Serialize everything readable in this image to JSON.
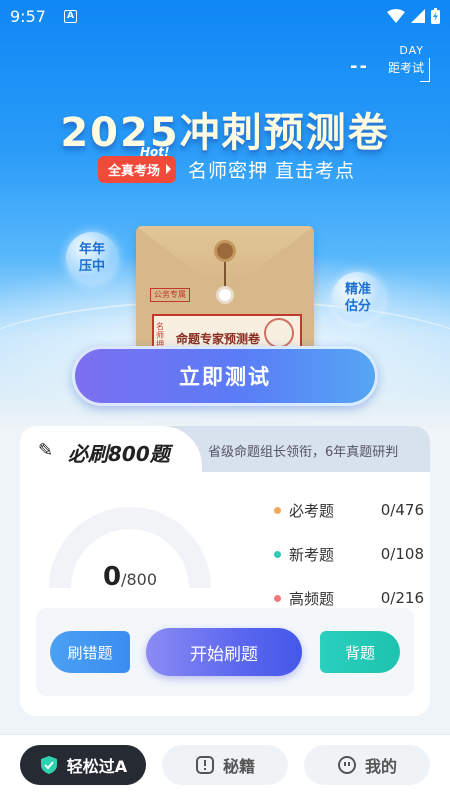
{
  "status_bar": {
    "time": "9:57",
    "sim_badge": "A"
  },
  "countdown": {
    "value": "--",
    "unit": "DAY",
    "label": "距考试"
  },
  "hero": {
    "headline": "2025冲刺预测卷",
    "tag": "全真考场",
    "hot": "Hot!",
    "slogan": "名师密押 直击考点",
    "bubble_left": "年年\n压中",
    "bubble_right": "精准\n估分",
    "envelope_stamp": "公务专属",
    "envelope_title": "命题专家预测卷",
    "envelope_side": "名师押"
  },
  "test_button": {
    "label": "立即测试"
  },
  "practice": {
    "title": "必刷800题",
    "subtitle": "省级命题组长领衔，6年真题研判",
    "progress_done": "0",
    "progress_total": "/800",
    "progress_fraction": 0,
    "stats": [
      {
        "label": "必考题",
        "value": "0/476",
        "color": "#f5a85a"
      },
      {
        "label": "新考题",
        "value": "0/108",
        "color": "#2cc9b3"
      },
      {
        "label": "高频题",
        "value": "0/216",
        "color": "#f2787a"
      }
    ],
    "btn_wrong": "刷错题",
    "btn_start": "开始刷题",
    "btn_recite": "背题"
  },
  "tabs": [
    {
      "label": "轻松过A",
      "icon": "shield-check-icon",
      "active": true
    },
    {
      "label": "秘籍",
      "icon": "book-alert-icon",
      "active": false
    },
    {
      "label": "我的",
      "icon": "face-icon",
      "active": false
    }
  ]
}
